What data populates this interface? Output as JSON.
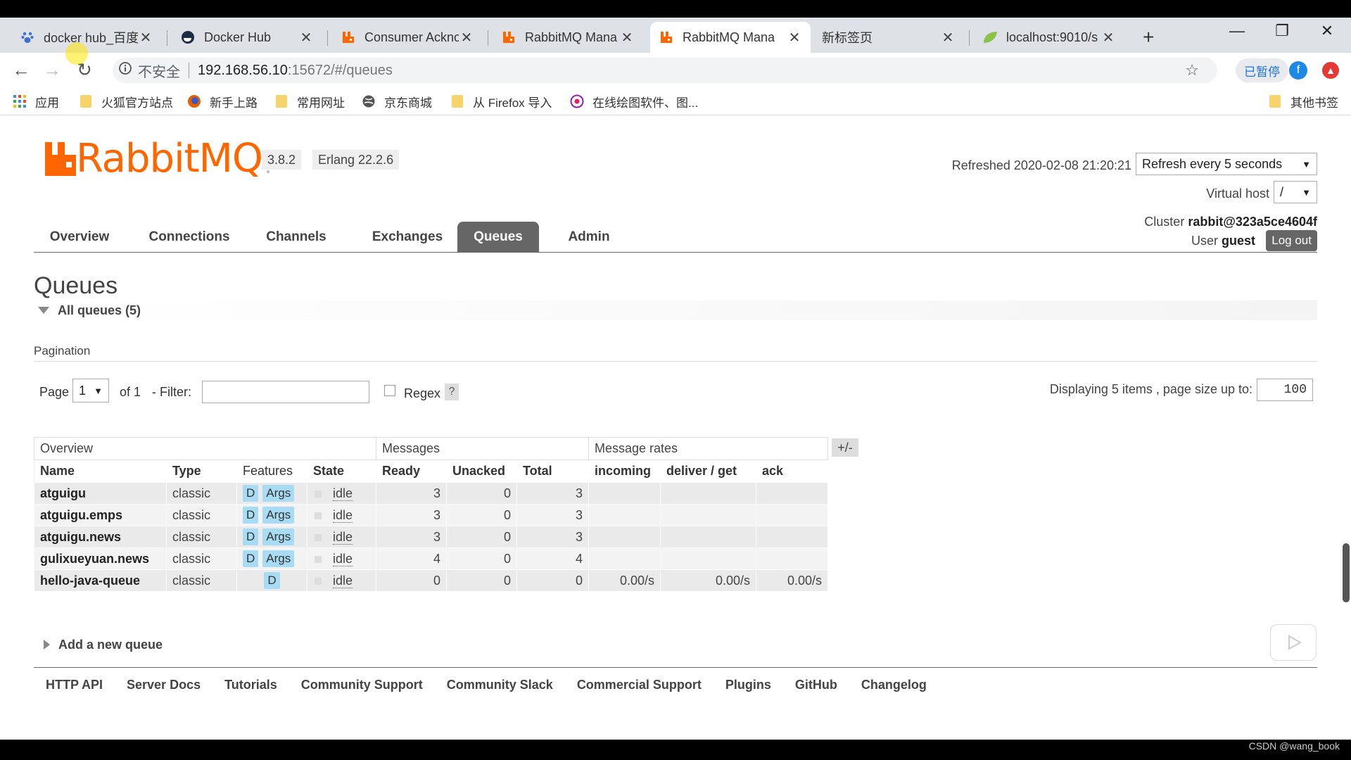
{
  "browser": {
    "tabs": [
      {
        "title": "docker hub_百度",
        "icon": "baidu-paw-icon"
      },
      {
        "title": "Docker Hub",
        "icon": "docker-icon"
      },
      {
        "title": "Consumer Ackno",
        "icon": "rabbitmq-icon"
      },
      {
        "title": "RabbitMQ Mana",
        "icon": "rabbitmq-icon"
      },
      {
        "title": "RabbitMQ Mana",
        "icon": "rabbitmq-icon"
      },
      {
        "title": "新标签页",
        "icon": ""
      },
      {
        "title": "localhost:9010/s",
        "icon": "spring-leaf-icon"
      }
    ],
    "active_tab": 4,
    "new_tab": "+",
    "address": {
      "insecure": "不安全",
      "host": "192.168.56.10",
      "path": ":15672/#/queues"
    },
    "paused_label": "已暂停",
    "avatar_letter": "f",
    "bookmarks": [
      "应用",
      "火狐官方站点",
      "新手上路",
      "常用网址",
      "京东商城",
      "从 Firefox 导入",
      "在线绘图软件、图...",
      "其他书签"
    ]
  },
  "header": {
    "logo": "RabbitMQ",
    "version": "3.8.2",
    "erlang": "Erlang 22.2.6",
    "refreshed": "Refreshed 2020-02-08 21:20:21",
    "refresh_select": "Refresh every 5 seconds",
    "vhost_label": "Virtual host",
    "vhost_value": "/",
    "cluster_label": "Cluster",
    "cluster_name": "rabbit@323a5ce4604f",
    "user_label": "User",
    "user_name": "guest",
    "logout": "Log out"
  },
  "nav": [
    "Overview",
    "Connections",
    "Channels",
    "Exchanges",
    "Queues",
    "Admin"
  ],
  "nav_active": "Queues",
  "queues": {
    "title": "Queues",
    "all_label": "All queues (5)",
    "pagination_label": "Pagination",
    "page_label": "Page",
    "page_value": "1",
    "of_label": "of 1",
    "filter_label": "- Filter:",
    "regex_label": "Regex",
    "help": "?",
    "displaying": "Displaying 5 items , page size up to:",
    "page_size": "100",
    "plusminus": "+/-",
    "groups": {
      "overview": "Overview",
      "messages": "Messages",
      "rates": "Message rates"
    },
    "columns": {
      "name": "Name",
      "type": "Type",
      "features": "Features",
      "state": "State",
      "ready": "Ready",
      "unacked": "Unacked",
      "total": "Total",
      "incoming": "incoming",
      "deliver": "deliver / get",
      "ack": "ack"
    },
    "feature_d": "D",
    "feature_args": "Args",
    "rows": [
      {
        "name": "atguigu",
        "type": "classic",
        "args": true,
        "state": "idle",
        "ready": "3",
        "unacked": "0",
        "total": "3",
        "incoming": "",
        "deliver": "",
        "ack": ""
      },
      {
        "name": "atguigu.emps",
        "type": "classic",
        "args": true,
        "state": "idle",
        "ready": "3",
        "unacked": "0",
        "total": "3",
        "incoming": "",
        "deliver": "",
        "ack": ""
      },
      {
        "name": "atguigu.news",
        "type": "classic",
        "args": true,
        "state": "idle",
        "ready": "3",
        "unacked": "0",
        "total": "3",
        "incoming": "",
        "deliver": "",
        "ack": ""
      },
      {
        "name": "gulixueyuan.news",
        "type": "classic",
        "args": true,
        "state": "idle",
        "ready": "4",
        "unacked": "0",
        "total": "4",
        "incoming": "",
        "deliver": "",
        "ack": ""
      },
      {
        "name": "hello-java-queue",
        "type": "classic",
        "args": false,
        "state": "idle",
        "ready": "0",
        "unacked": "0",
        "total": "0",
        "incoming": "0.00/s",
        "deliver": "0.00/s",
        "ack": "0.00/s"
      }
    ],
    "add_label": "Add a new queue"
  },
  "footer": [
    "HTTP API",
    "Server Docs",
    "Tutorials",
    "Community Support",
    "Community Slack",
    "Commercial Support",
    "Plugins",
    "GitHub",
    "Changelog"
  ],
  "watermark": "CSDN @wang_book",
  "colors": {
    "brand": "#ff6600",
    "active_nav": "#666666",
    "badge": "#a7dcf4"
  }
}
